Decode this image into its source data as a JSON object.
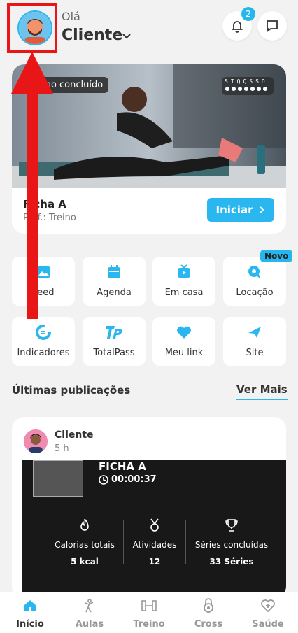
{
  "header": {
    "greeting": "Olá",
    "user_name": "Cliente",
    "notification_count": "2"
  },
  "hero": {
    "status_tag": "Treino concluído",
    "week_letters": "STQQSSD",
    "title": "Ficha A",
    "subtitle": "Prof.: Treino",
    "start_label": "Iniciar"
  },
  "shortcuts": [
    {
      "label": "Feed",
      "icon": "image-icon"
    },
    {
      "label": "Agenda",
      "icon": "calendar-icon"
    },
    {
      "label": "Em casa",
      "icon": "tv-icon"
    },
    {
      "label": "Locação",
      "icon": "location-chat-icon"
    },
    {
      "label": "Indicadores",
      "icon": "indicators-icon"
    },
    {
      "label": "TotalPass",
      "icon": "totalpass-icon"
    },
    {
      "label": "Meu link",
      "icon": "heart-icon"
    },
    {
      "label": "Site",
      "icon": "paper-plane-icon"
    }
  ],
  "new_badge": "Novo",
  "publications": {
    "title": "Últimas publicações",
    "see_more": "Ver Mais",
    "post": {
      "author": "Cliente",
      "time": "5 h",
      "workout": "FICHA A",
      "duration": "00:00:37",
      "stats": [
        {
          "label": "Calorias totais",
          "value": "5 kcal",
          "icon": "flame-icon"
        },
        {
          "label": "Atividades",
          "value": "12",
          "icon": "medal-icon"
        },
        {
          "label": "Séries concluídas",
          "value": "33 Séries",
          "icon": "trophy-icon"
        }
      ]
    }
  },
  "nav": [
    {
      "label": "Início",
      "icon": "home-icon"
    },
    {
      "label": "Aulas",
      "icon": "dance-icon"
    },
    {
      "label": "Treino",
      "icon": "barbell-icon"
    },
    {
      "label": "Cross",
      "icon": "kettlebell-icon"
    },
    {
      "label": "Saúde",
      "icon": "health-heart-icon"
    }
  ],
  "colors": {
    "accent": "#2ab7f0",
    "annotation": "#e81616"
  }
}
